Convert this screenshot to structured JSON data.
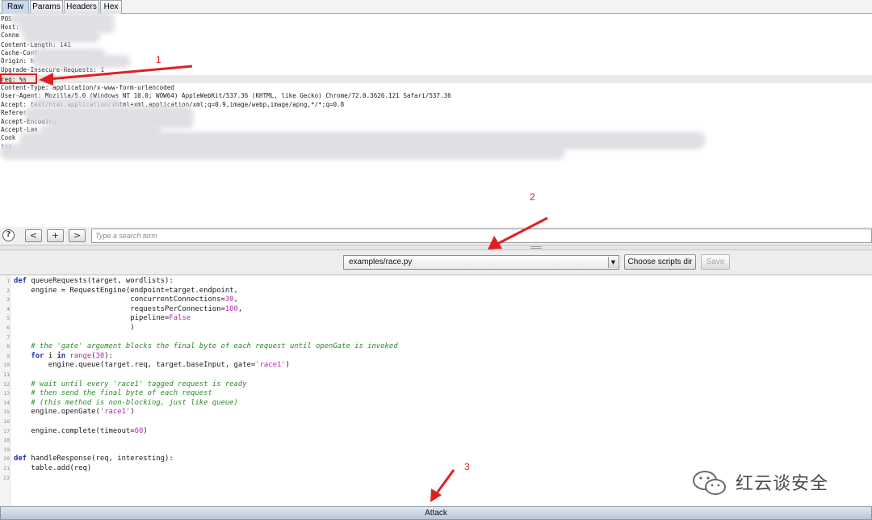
{
  "tabs": [
    {
      "label": "Raw",
      "active": true
    },
    {
      "label": "Params",
      "active": false
    },
    {
      "label": "Headers",
      "active": false
    },
    {
      "label": "Hex",
      "active": false
    }
  ],
  "request_lines": [
    "POS",
    "Host:",
    "Conne",
    "Content-Length: 141",
    "Cache-Cont",
    "Origin: h",
    "Upgrade-Insecure-Requests: 1",
    "req: %s",
    "Content-Type: application/x-www-form-urlencoded",
    "User-Agent: Mozilla/5.0 (Windows NT 10.0; WOW64) AppleWebKit/537.36 (KHTML, like Gecko) Chrome/72.0.3626.121 Safari/537.36",
    "Accept: text/html,application/xhtml+xml,application/xml;q=0.9,image/webp,image/apng,*/*;q=0.8",
    "Referer",
    "Accept-Encoding",
    "Accept-Lan",
    "Cook",
    "top"
  ],
  "annotations": [
    "1",
    "2",
    "3"
  ],
  "search": {
    "help_icon_label": "?",
    "prev_label": "<",
    "add_label": "+",
    "next_label": ">",
    "placeholder": "Type a search term"
  },
  "scripts": {
    "selected": "examples/race.py",
    "choose_dir_label": "Choose scripts dir",
    "save_label": "Save"
  },
  "code_lines": [
    [
      {
        "t": "kw",
        "v": "def "
      },
      {
        "t": "fn",
        "v": "queueRequests(target, wordlists):"
      }
    ],
    [
      {
        "t": "fn",
        "v": "    engine = RequestEngine(endpoint=target.endpoint,"
      }
    ],
    [
      {
        "t": "fn",
        "v": "                           concurrentConnections="
      },
      {
        "t": "num",
        "v": "30"
      },
      {
        "t": "fn",
        "v": ","
      }
    ],
    [
      {
        "t": "fn",
        "v": "                           requestsPerConnection="
      },
      {
        "t": "num",
        "v": "100"
      },
      {
        "t": "fn",
        "v": ","
      }
    ],
    [
      {
        "t": "fn",
        "v": "                           pipeline="
      },
      {
        "t": "blt",
        "v": "False"
      }
    ],
    [
      {
        "t": "fn",
        "v": "                           )"
      }
    ],
    [],
    [
      {
        "t": "cmt",
        "v": "    # the 'gate' argument blocks the final byte of each request until openGate is invoked"
      }
    ],
    [
      {
        "t": "kw",
        "v": "    for "
      },
      {
        "t": "fn",
        "v": "i "
      },
      {
        "t": "kw",
        "v": "in "
      },
      {
        "t": "blt",
        "v": "range"
      },
      {
        "t": "fn",
        "v": "("
      },
      {
        "t": "num",
        "v": "30"
      },
      {
        "t": "fn",
        "v": "):"
      }
    ],
    [
      {
        "t": "fn",
        "v": "        engine.queue(target.req, target.baseInput, gate="
      },
      {
        "t": "str",
        "v": "'race1'"
      },
      {
        "t": "fn",
        "v": ")"
      }
    ],
    [],
    [
      {
        "t": "cmt",
        "v": "    # wait until every 'race1' tagged request is ready"
      }
    ],
    [
      {
        "t": "cmt",
        "v": "    # then send the final byte of each request"
      }
    ],
    [
      {
        "t": "cmt",
        "v": "    # (this method is non-blocking, just like queue)"
      }
    ],
    [
      {
        "t": "fn",
        "v": "    engine.openGate("
      },
      {
        "t": "str",
        "v": "'race1'"
      },
      {
        "t": "fn",
        "v": ")"
      }
    ],
    [],
    [
      {
        "t": "fn",
        "v": "    engine.complete(timeout="
      },
      {
        "t": "num",
        "v": "60"
      },
      {
        "t": "fn",
        "v": ")"
      }
    ],
    [],
    [],
    [
      {
        "t": "kw",
        "v": "def "
      },
      {
        "t": "fn",
        "v": "handleResponse(req, interesting):"
      }
    ],
    [
      {
        "t": "fn",
        "v": "    table.add(req)"
      }
    ],
    []
  ],
  "attack_label": "Attack",
  "watermark": "红云谈安全",
  "colors": {
    "annotation": "#e02020",
    "tab_active": "#c9d9ef"
  }
}
